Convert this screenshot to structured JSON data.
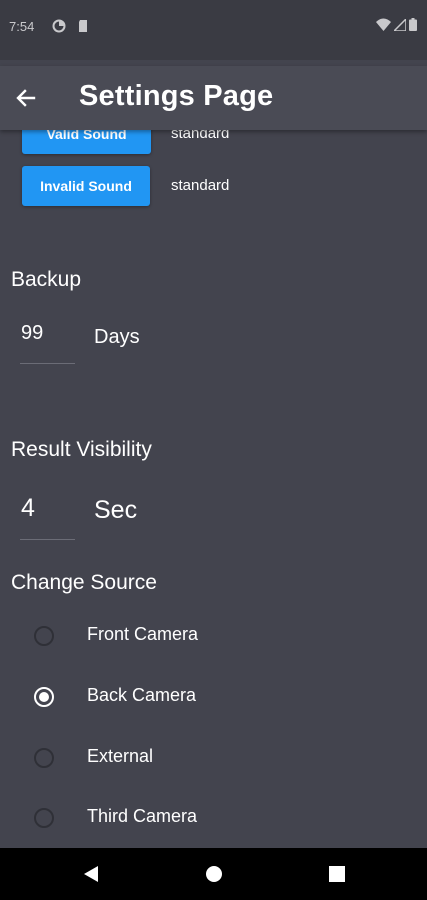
{
  "status_bar": {
    "time": "7:54"
  },
  "app_bar": {
    "title": "Settings Page"
  },
  "sounds": [
    {
      "button_label": "Valid Sound",
      "value": "standard"
    },
    {
      "button_label": "Invalid Sound",
      "value": "standard"
    }
  ],
  "backup": {
    "title": "Backup",
    "value": "99",
    "unit": "Days"
  },
  "result_visibility": {
    "title": "Result Visibility",
    "value": "4",
    "unit": "Sec"
  },
  "change_source": {
    "title": "Change Source",
    "options": [
      "Front Camera",
      "Back Camera",
      "External",
      "Third Camera"
    ],
    "selected": "Back Camera"
  },
  "colors": {
    "accent": "#2196f3",
    "background": "#43444e",
    "app_bar": "#4a4b55"
  }
}
